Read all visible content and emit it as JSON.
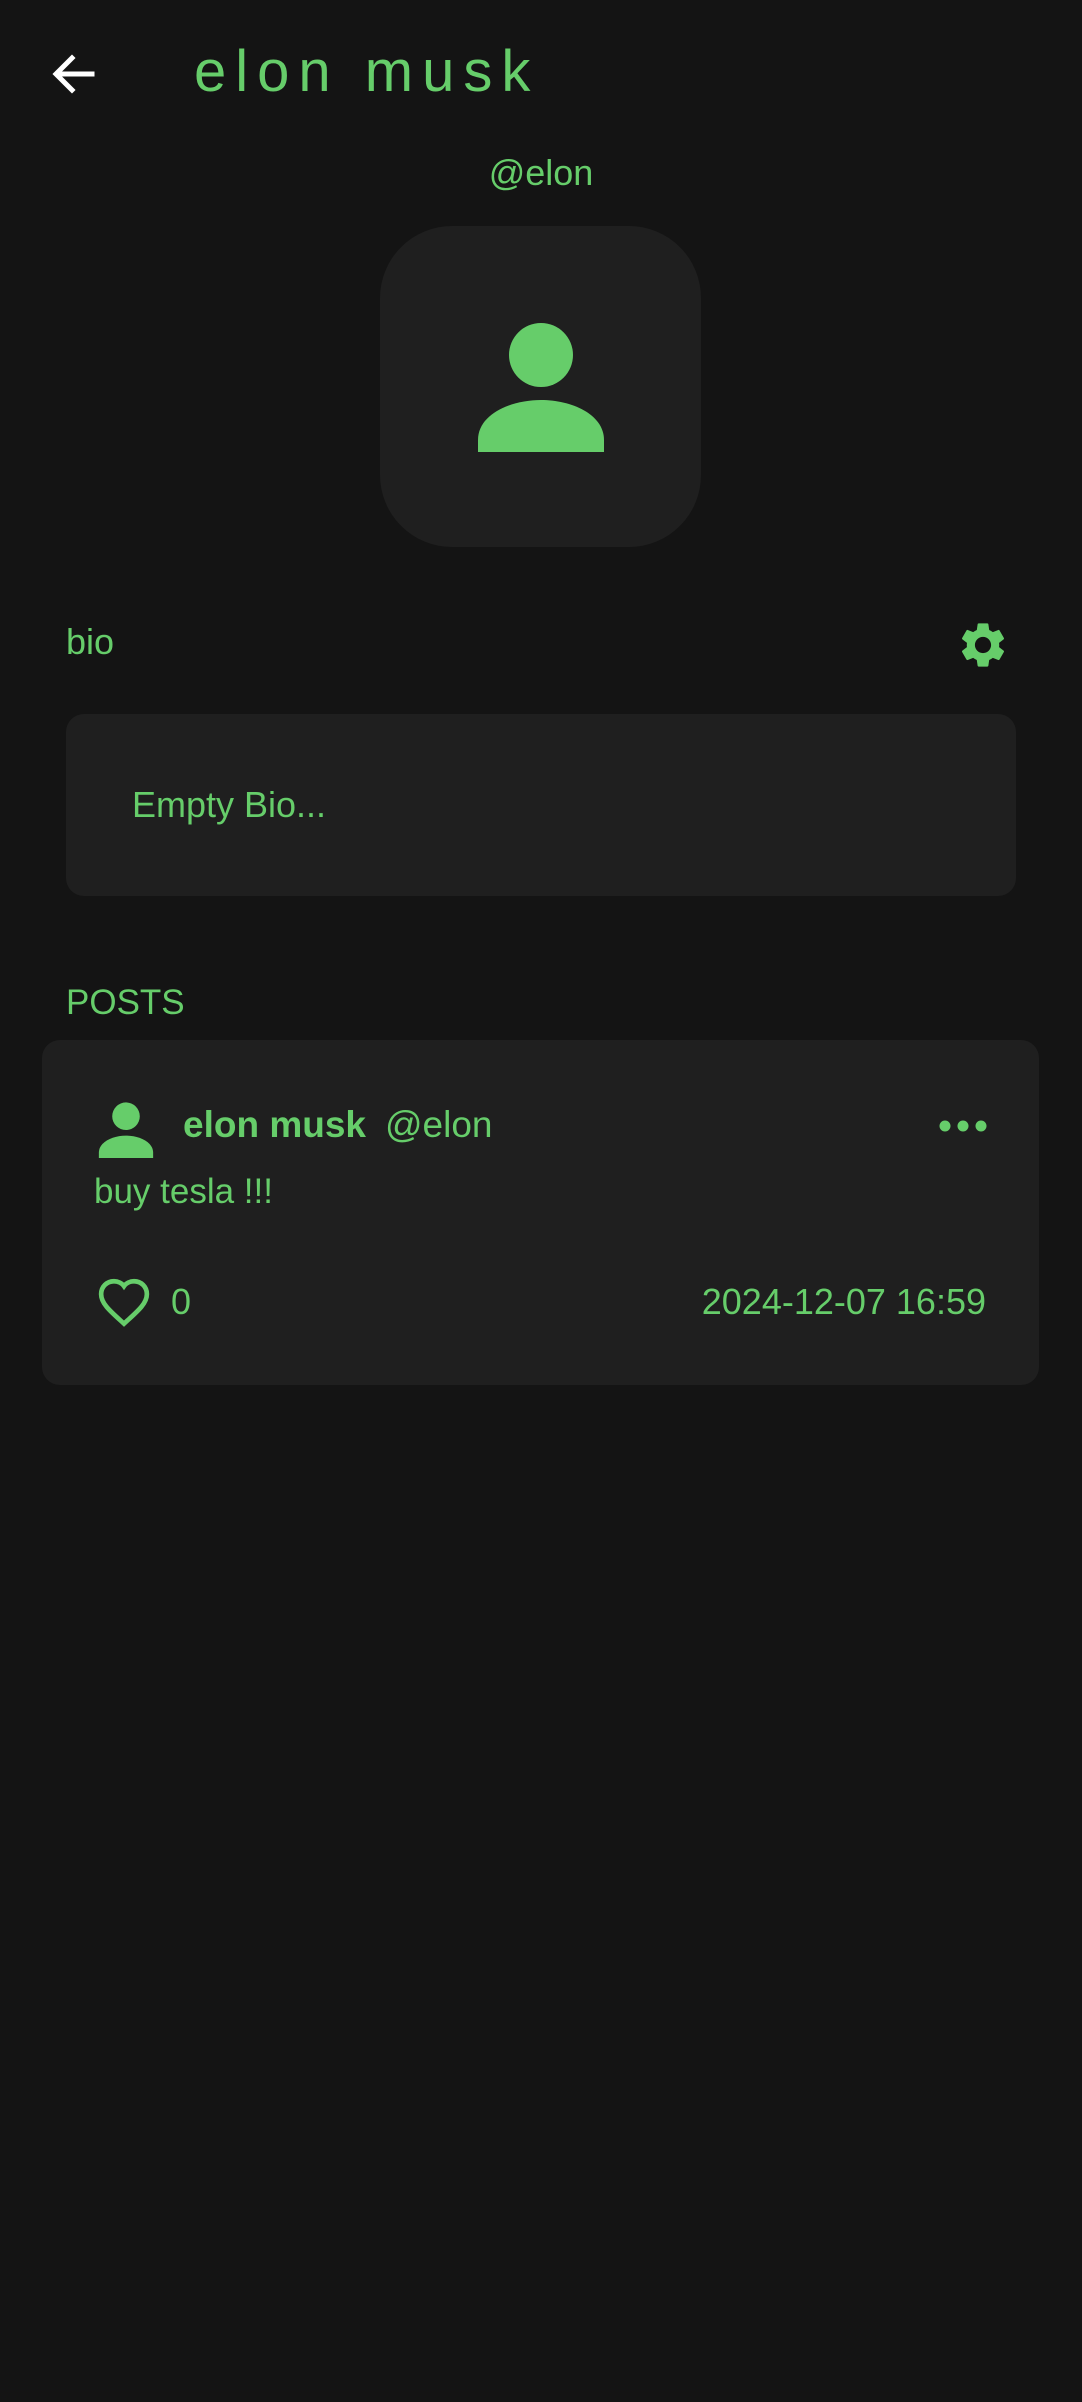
{
  "app_bar": {
    "title": "elon musk",
    "back_icon": "arrow-left-icon"
  },
  "profile": {
    "username": "@elon",
    "avatar_icon": "person-icon"
  },
  "bio": {
    "label": "bio",
    "settings_icon": "gear-icon",
    "text": "Empty Bio..."
  },
  "posts": {
    "label": "POSTS",
    "items": [
      {
        "author": "elon musk",
        "handle": "@elon",
        "text": "buy tesla !!!",
        "likes": "0",
        "timestamp": "2024-12-07 16:59",
        "more_icon": "more-horizontal-icon",
        "like_icon": "heart-outline-icon"
      }
    ]
  },
  "colors": {
    "background": "#141414",
    "surface": "#1f1f1f",
    "accent": "#66cd6a",
    "back_icon": "#ffffff"
  }
}
